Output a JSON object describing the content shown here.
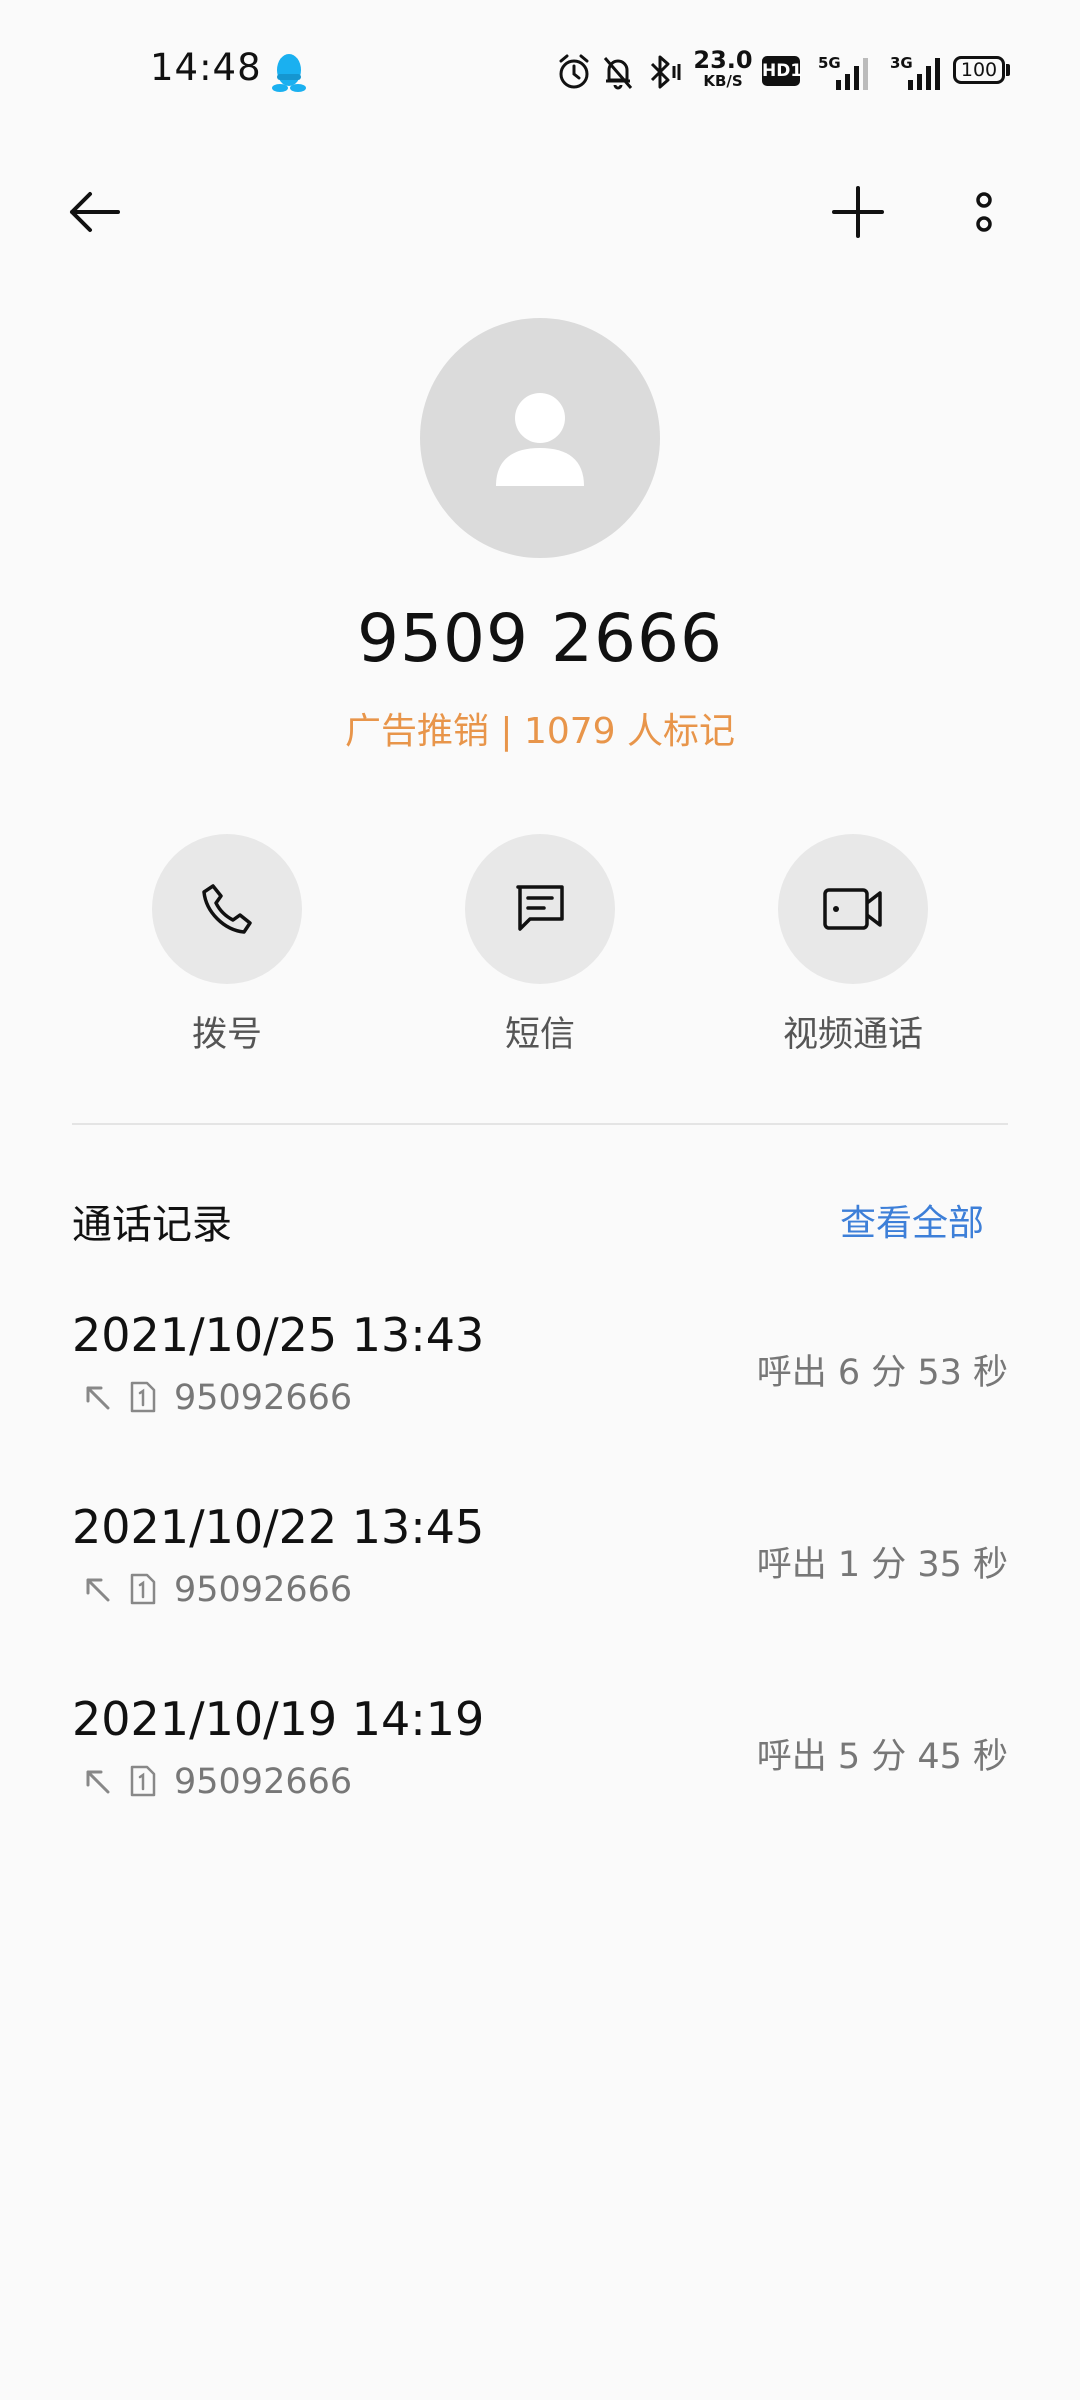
{
  "status_bar": {
    "time": "14:48",
    "net_speed_value": "23.0",
    "net_speed_unit": "KB/S",
    "hd_label": "HD1",
    "net_5g": "5G",
    "net_3g": "3G",
    "battery": "100",
    "icons": [
      "qq-icon",
      "alarm-icon",
      "bell-off-icon",
      "bluetooth-icon",
      "signal-icon",
      "battery-icon"
    ]
  },
  "contact": {
    "number": "9509 2666",
    "tag": "广告推销 | 1079 人标记"
  },
  "actions": [
    {
      "label": "拨号",
      "icon": "phone-icon"
    },
    {
      "label": "短信",
      "icon": "message-icon"
    },
    {
      "label": "视频通话",
      "icon": "video-call-icon"
    }
  ],
  "call_log": {
    "title": "通话记录",
    "view_all": "查看全部",
    "entries": [
      {
        "datetime": "2021/10/25 13:43",
        "number": "95092666",
        "type_duration": "呼出  6 分 53 秒"
      },
      {
        "datetime": "2021/10/22 13:45",
        "number": "95092666",
        "type_duration": "呼出  1 分 35 秒"
      },
      {
        "datetime": "2021/10/19 14:19",
        "number": "95092666",
        "type_duration": "呼出  5 分 45 秒"
      }
    ]
  },
  "colors": {
    "background": "#fafafa",
    "tag": "#e8954a",
    "link": "#3d7fd8",
    "secondary_text": "#777777"
  }
}
